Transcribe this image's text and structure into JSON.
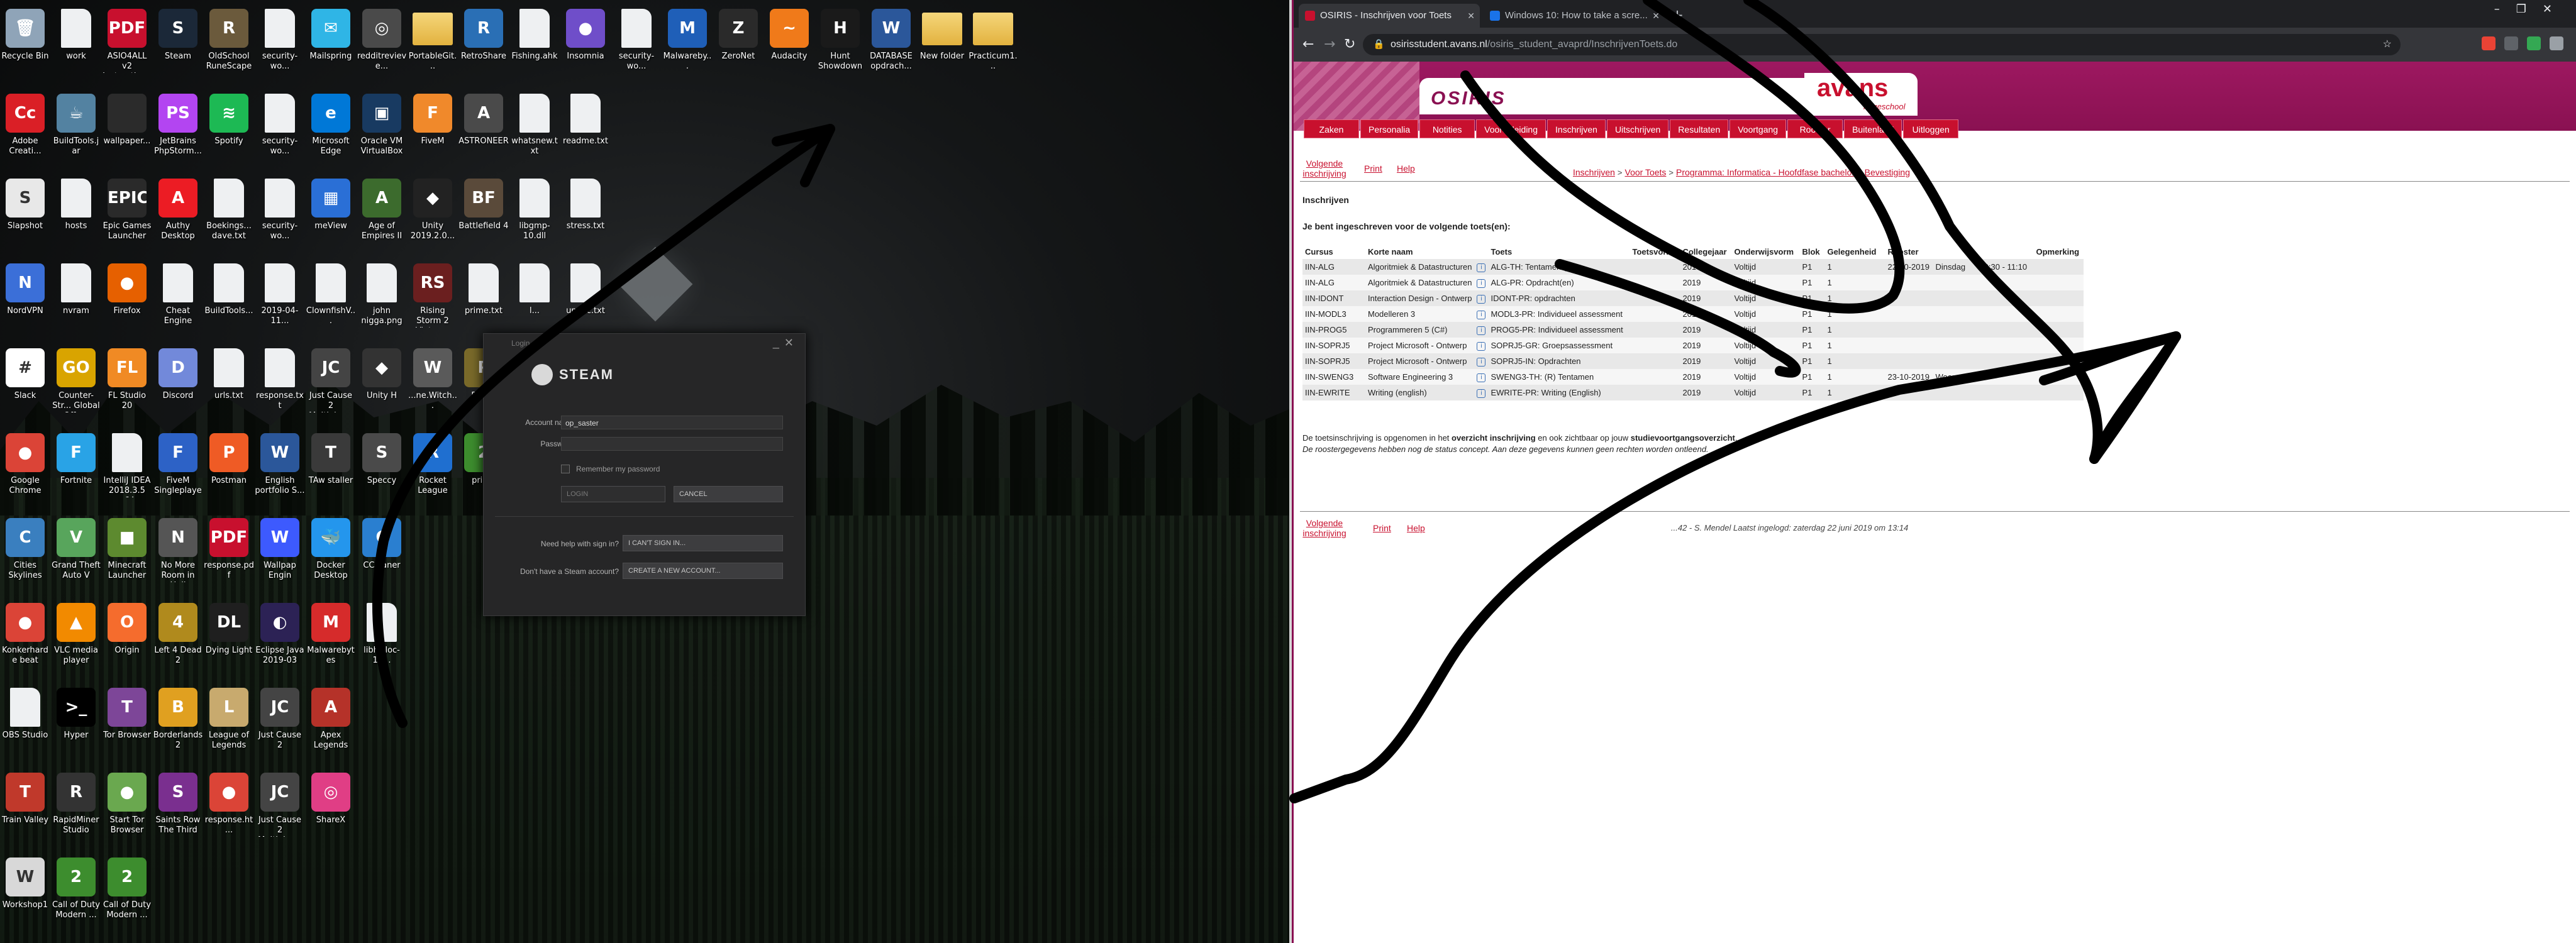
{
  "desktop": {
    "columns": [
      [
        {
          "label": "Recycle Bin",
          "glyph": "🗑",
          "color": "#8fa4b8"
        },
        {
          "label": "Adobe Creati...",
          "glyph": "Cc",
          "color": "#da1f26"
        },
        {
          "label": "Slapshot",
          "glyph": "S",
          "color": "#e8e8e8"
        },
        {
          "label": "NordVPN",
          "glyph": "N",
          "color": "#3b6fd8"
        },
        {
          "label": "Slack",
          "glyph": "#",
          "color": "#ffffff"
        },
        {
          "label": "Google Chrome",
          "glyph": "●",
          "color": "#db4437"
        },
        {
          "label": "Cities Skylines",
          "glyph": "C",
          "color": "#3a7fbf"
        },
        {
          "label": "Konkerharde beat",
          "glyph": "●",
          "color": "#db4437"
        },
        {
          "label": "OBS Studio",
          "glyph": "",
          "color": "doc"
        },
        {
          "label": "Train Valley",
          "glyph": "T",
          "color": "#c0392b"
        },
        {
          "label": "Workshop1",
          "glyph": "W",
          "color": "#d8d8d8"
        }
      ],
      [
        {
          "label": "work",
          "glyph": "",
          "color": "doc"
        },
        {
          "label": "BuildTools.jar",
          "glyph": "☕",
          "color": "#5382a1"
        },
        {
          "label": "hosts",
          "glyph": "",
          "color": "doc"
        },
        {
          "label": "nvram",
          "glyph": "",
          "color": "doc"
        },
        {
          "label": "Counter-Str... Global Offe...",
          "glyph": "GO",
          "color": "#d9a400"
        },
        {
          "label": "Fortnite",
          "glyph": "F",
          "color": "#29a3e6"
        },
        {
          "label": "Grand Theft Auto V",
          "glyph": "V",
          "color": "#58a55c"
        },
        {
          "label": "VLC media player",
          "glyph": "▲",
          "color": "#f28a00"
        },
        {
          "label": "Hyper",
          "glyph": ">_",
          "color": "#000000"
        },
        {
          "label": "RapidMiner Studio",
          "glyph": "R",
          "color": "#333333"
        },
        {
          "label": "Call of Duty Modern ...",
          "glyph": "2",
          "color": "#3d8d2e"
        }
      ],
      [
        {
          "label": "ASIO4ALL v2 Instruction...",
          "glyph": "PDF",
          "color": "#c8102e"
        },
        {
          "label": "wallpaper...",
          "glyph": "",
          "color": "#2b2b2b"
        },
        {
          "label": "Epic Games Launcher",
          "glyph": "EPIC",
          "color": "#2a2a2a"
        },
        {
          "label": "Firefox",
          "glyph": "●",
          "color": "#e66000"
        },
        {
          "label": "FL Studio 20",
          "glyph": "FL",
          "color": "#f08a24"
        },
        {
          "label": "IntelliJ IDEA 2018.3.5 x64",
          "glyph": "",
          "color": "doc"
        },
        {
          "label": "Minecraft Launcher",
          "glyph": "■",
          "color": "#5d8a2f"
        },
        {
          "label": "Origin",
          "glyph": "O",
          "color": "#f56c2d"
        },
        {
          "label": "Tor Browser",
          "glyph": "T",
          "color": "#7d4698"
        },
        {
          "label": "Start Tor Browser",
          "glyph": "●",
          "color": "#6aa84f"
        },
        {
          "label": "Call of Duty Modern ...",
          "glyph": "2",
          "color": "#3d8d2e"
        }
      ],
      [
        {
          "label": "Steam",
          "glyph": "S",
          "color": "#1b2838"
        },
        {
          "label": "JetBrains PhpStorm...",
          "glyph": "PS",
          "color": "#b345f1"
        },
        {
          "label": "Authy Desktop",
          "glyph": "A",
          "color": "#ec1c24"
        },
        {
          "label": "Cheat Engine",
          "glyph": "",
          "color": "doc"
        },
        {
          "label": "Discord",
          "glyph": "D",
          "color": "#7289da"
        },
        {
          "label": "FiveM Singleplayer",
          "glyph": "F",
          "color": "#2d62c6"
        },
        {
          "label": "No More Room in Hell",
          "glyph": "N",
          "color": "#555555"
        },
        {
          "label": "Left 4 Dead 2",
          "glyph": "4",
          "color": "#b08a1d"
        },
        {
          "label": "Borderlands 2",
          "glyph": "B",
          "color": "#e0a020"
        },
        {
          "label": "Saints Row The Third",
          "glyph": "S",
          "color": "#7a2f8f"
        }
      ],
      [
        {
          "label": "OldSchool RuneScape",
          "glyph": "R",
          "color": "#6b5a3c"
        },
        {
          "label": "Spotify",
          "glyph": "≋",
          "color": "#1db954"
        },
        {
          "label": "Boekings... dave.txt",
          "glyph": "",
          "color": "doc"
        },
        {
          "label": "BuildTools...",
          "glyph": "",
          "color": "doc"
        },
        {
          "label": "urls.txt",
          "glyph": "",
          "color": "doc"
        },
        {
          "label": "Postman",
          "glyph": "P",
          "color": "#ef5b25"
        },
        {
          "label": "response.pdf",
          "glyph": "PDF",
          "color": "#c8102e"
        },
        {
          "label": "Dying Light",
          "glyph": "DL",
          "color": "#1f1f1f"
        },
        {
          "label": "League of Legends",
          "glyph": "L",
          "color": "#c8aa6e"
        },
        {
          "label": "response.ht...",
          "glyph": "●",
          "color": "#db4437"
        }
      ],
      [
        {
          "label": "security-wo...",
          "glyph": "",
          "color": "doc"
        },
        {
          "label": "security-wo...",
          "glyph": "",
          "color": "doc"
        },
        {
          "label": "security-wo...",
          "glyph": "",
          "color": "doc"
        },
        {
          "label": "2019-04-11...",
          "glyph": "",
          "color": "doc"
        },
        {
          "label": "response.txt",
          "glyph": "",
          "color": "doc"
        },
        {
          "label": "English portfolio S...",
          "glyph": "W",
          "color": "#2b579a"
        },
        {
          "label": "Wallpap Engin",
          "glyph": "W",
          "color": "#3d5afe"
        },
        {
          "label": "Eclipse Java 2019-03",
          "glyph": "◐",
          "color": "#2c2255"
        },
        {
          "label": "Just Cause 2",
          "glyph": "JC",
          "color": "#444444"
        },
        {
          "label": "Just Cause 2 Multiplay...",
          "glyph": "JC",
          "color": "#444444"
        }
      ],
      [
        {
          "label": "Mailspring",
          "glyph": "✉",
          "color": "#2fb5e6"
        },
        {
          "label": "Microsoft Edge",
          "glyph": "e",
          "color": "#0078d7"
        },
        {
          "label": "meView",
          "glyph": "▦",
          "color": "#2a6fd6"
        },
        {
          "label": "ClownfishV...",
          "glyph": "",
          "color": "doc"
        },
        {
          "label": "Just Cause 2 Multiplay...",
          "glyph": "JC",
          "color": "#444444"
        },
        {
          "label": "TAw staller",
          "glyph": "T",
          "color": "#3a3a3a"
        },
        {
          "label": "Docker Desktop",
          "glyph": "🐳",
          "color": "#2496ed"
        },
        {
          "label": "Malwarebytes",
          "glyph": "M",
          "color": "#d62b2b"
        },
        {
          "label": "Apex Legends",
          "glyph": "A",
          "color": "#b53229"
        },
        {
          "label": "ShareX",
          "glyph": "◎",
          "color": "#e03e85"
        }
      ],
      [
        {
          "label": "redditrevieve...",
          "glyph": "◎",
          "color": "#4a4a4a"
        },
        {
          "label": "Oracle VM VirtualBox",
          "glyph": "▣",
          "color": "#183a61"
        },
        {
          "label": "Age of Empires II ...",
          "glyph": "A",
          "color": "#3c6b2d"
        },
        {
          "label": "john nigga.png",
          "glyph": "",
          "color": "doc"
        },
        {
          "label": "Unity H",
          "glyph": "◆",
          "color": "#333333"
        },
        {
          "label": "Speccy",
          "glyph": "S",
          "color": "#4a4a4a"
        },
        {
          "label": "CCleaner",
          "glyph": "C",
          "color": "#2a7fd0"
        },
        {
          "label": "libhwloc-15...",
          "glyph": "",
          "color": "doc"
        }
      ],
      [
        {
          "label": "PortableGit...",
          "glyph": "",
          "color": "folder"
        },
        {
          "label": "FiveM",
          "glyph": "F",
          "color": "#f0892b"
        },
        {
          "label": "Unity 2019.2.0...",
          "glyph": "◆",
          "color": "#222222"
        },
        {
          "label": "Rising Storm 2 Vietnam",
          "glyph": "RS",
          "color": "#6b1f1f"
        },
        {
          "label": "...ne.Witch...",
          "glyph": "W",
          "color": "#5a5a5a"
        },
        {
          "label": "Rocket League",
          "glyph": "R",
          "color": "#1f6fd0"
        }
      ],
      [
        {
          "label": "RetroShare",
          "glyph": "R",
          "color": "#2a6fb5"
        },
        {
          "label": "ASTRONEER",
          "glyph": "A",
          "color": "#4a4a4a"
        },
        {
          "label": "Battlefield 4",
          "glyph": "BF",
          "color": "#5a4a3a"
        },
        {
          "label": "prime.txt",
          "glyph": "",
          "color": "doc"
        },
        {
          "label": "Pulp.F",
          "glyph": "P",
          "color": "#7a6a2a"
        },
        {
          "label": "prime",
          "glyph": "2",
          "color": "#3d8d2e"
        }
      ],
      [
        {
          "label": "Fishing.ahk",
          "glyph": "",
          "color": "doc"
        },
        {
          "label": "whatsnew.txt",
          "glyph": "",
          "color": "doc"
        },
        {
          "label": "libgmp-10.dll",
          "glyph": "",
          "color": "doc"
        },
        {
          "label": "l...",
          "glyph": "",
          "color": "doc"
        }
      ],
      [
        {
          "label": "Insomnia",
          "glyph": "●",
          "color": "#6f4ec9"
        },
        {
          "label": "readme.txt",
          "glyph": "",
          "color": "doc"
        },
        {
          "label": "stress.txt",
          "glyph": "",
          "color": "doc"
        },
        {
          "label": "undoc.txt",
          "glyph": "",
          "color": "doc"
        }
      ],
      [
        {
          "label": "security-wo...",
          "glyph": "",
          "color": "doc"
        }
      ],
      [
        {
          "label": "Malwareby...",
          "glyph": "M",
          "color": "#1f5fb8"
        }
      ],
      [
        {
          "label": "ZeroNet",
          "glyph": "Z",
          "color": "#2a2a2a"
        }
      ],
      [
        {
          "label": "Audacity",
          "glyph": "~",
          "color": "#f07a1a"
        }
      ],
      [
        {
          "label": "Hunt Showdown",
          "glyph": "H",
          "color": "#1a1a1a"
        }
      ],
      [
        {
          "label": "DATABASE opdrach...",
          "glyph": "W",
          "color": "#2b579a"
        }
      ],
      [
        {
          "label": "New folder",
          "glyph": "",
          "color": "folder"
        }
      ],
      [
        {
          "label": "Practicum1...",
          "glyph": "",
          "color": "folder"
        }
      ]
    ]
  },
  "steam": {
    "title": "Login",
    "logo_text": "STEAM",
    "account_label": "Account name",
    "account_value": "op_saster",
    "password_label": "Password",
    "remember_label": "Remember my password",
    "login_button": "LOGIN",
    "cancel_button": "CANCEL",
    "help_question": "Need help with sign in?",
    "help_button": "I CAN'T SIGN IN...",
    "new_account_question": "Don't have a Steam account?",
    "new_account_button": "CREATE A NEW ACCOUNT..."
  },
  "browser": {
    "tabs": [
      {
        "title": "OSIRIS - Inschrijven voor Toets",
        "favicon_color": "#c8102e"
      },
      {
        "title": "Windows 10: How to take a scre...",
        "favicon_color": "#1a73e8"
      }
    ],
    "url_host": "osirisstudent.avans.nl",
    "url_path": "/osiris_student_avaprd/InschrijvenToets.do",
    "extension_colors": [
      "#ea4335",
      "#5f6368",
      "#34a853",
      "#9aa0a6"
    ]
  },
  "osiris": {
    "brand": "OSIRIS",
    "avans": "avans",
    "hogeschool": "hogeschool",
    "menu": [
      "Zaken",
      "Personalia",
      "Notities",
      "Vooropleiding",
      "Inschrijven",
      "Uitschrijven",
      "Resultaten",
      "Voortgang",
      "Rooster",
      "Buitenland",
      "Uitloggen"
    ],
    "sub_links": {
      "volgende": "Volgende inschrijving",
      "print": "Print",
      "help": "Help"
    },
    "breadcrumb": [
      "Inschrijven",
      "Voor Toets",
      "Programma: Informatica - Hoofdfase bachelor",
      "Bevestiging"
    ],
    "section_title": "Inschrijven",
    "intro": "Je bent ingeschreven voor de volgende toets(en):",
    "table": {
      "headers": [
        "Cursus",
        "Korte naam",
        "",
        "Toets",
        "Toetsvorm",
        "Collegejaar",
        "Onderwijsvorm",
        "Blok",
        "Gelegenheid",
        "Rooster",
        "",
        "",
        "Opmerking"
      ],
      "rows": [
        [
          "IIN-ALG",
          "Algoritmiek & Datastructuren",
          "i",
          "ALG-TH: Tentamen (R)",
          "",
          "2019",
          "Voltijd",
          "P1",
          "1",
          "22-10-2019",
          "Dinsdag",
          "09:30 - 11:10",
          ""
        ],
        [
          "IIN-ALG",
          "Algoritmiek & Datastructuren",
          "i",
          "ALG-PR: Opdracht(en)",
          "",
          "2019",
          "Voltijd",
          "P1",
          "1",
          "",
          "",
          "",
          ""
        ],
        [
          "IIN-IDONT",
          "Interaction Design - Ontwerp",
          "i",
          "IDONT-PR: opdrachten",
          "",
          "2019",
          "Voltijd",
          "P1",
          "1",
          "",
          "",
          "",
          ""
        ],
        [
          "IIN-MODL3",
          "Modelleren 3",
          "i",
          "MODL3-PR: Individueel assessment",
          "",
          "2019",
          "Voltijd",
          "P1",
          "1",
          "",
          "",
          "",
          ""
        ],
        [
          "IIN-PROG5",
          "Programmeren 5 (C#)",
          "i",
          "PROG5-PR: Individueel assessment",
          "",
          "2019",
          "Voltijd",
          "P1",
          "1",
          "",
          "",
          "",
          ""
        ],
        [
          "IIN-SOPRJ5",
          "Project Microsoft - Ontwerp",
          "i",
          "SOPRJ5-GR: Groepsassessment",
          "",
          "2019",
          "Voltijd",
          "P1",
          "1",
          "",
          "",
          "",
          ""
        ],
        [
          "IIN-SOPRJ5",
          "Project Microsoft - Ontwerp",
          "i",
          "SOPRJ5-IN: Opdrachten",
          "",
          "2019",
          "Voltijd",
          "P1",
          "1",
          "",
          "",
          "",
          ""
        ],
        [
          "IIN-SWENG3",
          "Software Engineering 3",
          "i",
          "SWENG3-TH: (R) Tentamen",
          "",
          "2019",
          "Voltijd",
          "P1",
          "1",
          "23-10-2019",
          "Woensdag",
          "",
          ""
        ],
        [
          "IIN-EWRITE",
          "Writing (english)",
          "i",
          "EWRITE-PR: Writing (English)",
          "",
          "2019",
          "Voltijd",
          "P1",
          "1",
          "",
          "",
          "",
          ""
        ]
      ]
    },
    "note_line1_a": "De toetsinschrijving is opgenomen in het ",
    "note_line1_b": "overzicht inschrijving",
    "note_line1_c": " en ook zichtbaar op jouw ",
    "note_line1_d": "studievoortgangsoverzicht",
    "note_line1_e": ".",
    "note_line2": "De roostergegevens hebben nog de status concept. Aan deze gegevens kunnen geen rechten worden ontleend.",
    "last_login": "...42 - S. Mendel    Laatst ingelogd: zaterdag 22 juni 2019 om 13:14"
  },
  "annotation": {
    "stroke_color": "#000000"
  }
}
